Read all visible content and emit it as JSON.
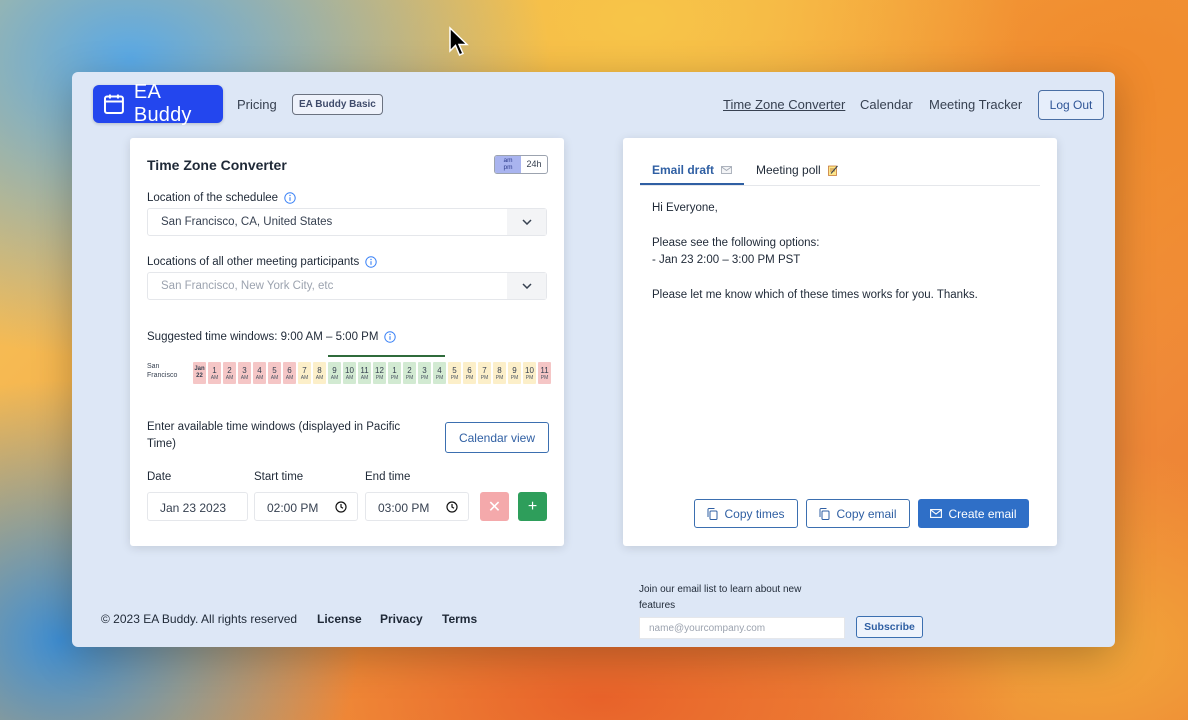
{
  "app": {
    "logo_text": "EA Buddy",
    "pricing_link": "Pricing",
    "plan_badge": "EA Buddy Basic"
  },
  "nav": {
    "time_zone_converter": "Time Zone Converter",
    "calendar": "Calendar",
    "meeting_tracker": "Meeting Tracker",
    "logout": "Log Out"
  },
  "converter": {
    "title": "Time Zone Converter",
    "toggle_ampm_top": "am",
    "toggle_ampm_bottom": "pm",
    "toggle_24h": "24h",
    "schedulee_label": "Location of the schedulee",
    "schedulee_value": "San Francisco, CA, United States",
    "participants_label": "Locations of all other meeting participants",
    "participants_placeholder": "San Francisco, New York City, etc",
    "suggested_label": "Suggested time windows: 9:00 AM – 5:00 PM",
    "timeline_location_line1": "San",
    "timeline_location_line2": "Francisco",
    "hours": [
      {
        "top": "Jan",
        "bottom": "22",
        "color": "red"
      },
      {
        "top": "1",
        "bottom": "AM",
        "color": "red"
      },
      {
        "top": "2",
        "bottom": "AM",
        "color": "red"
      },
      {
        "top": "3",
        "bottom": "AM",
        "color": "red"
      },
      {
        "top": "4",
        "bottom": "AM",
        "color": "red"
      },
      {
        "top": "5",
        "bottom": "AM",
        "color": "red"
      },
      {
        "top": "6",
        "bottom": "AM",
        "color": "red"
      },
      {
        "top": "7",
        "bottom": "AM",
        "color": "yellow"
      },
      {
        "top": "8",
        "bottom": "AM",
        "color": "yellow"
      },
      {
        "top": "9",
        "bottom": "AM",
        "color": "green"
      },
      {
        "top": "10",
        "bottom": "AM",
        "color": "green"
      },
      {
        "top": "11",
        "bottom": "AM",
        "color": "green"
      },
      {
        "top": "12",
        "bottom": "PM",
        "color": "green"
      },
      {
        "top": "1",
        "bottom": "PM",
        "color": "green"
      },
      {
        "top": "2",
        "bottom": "PM",
        "color": "green"
      },
      {
        "top": "3",
        "bottom": "PM",
        "color": "green"
      },
      {
        "top": "4",
        "bottom": "PM",
        "color": "green"
      },
      {
        "top": "5",
        "bottom": "PM",
        "color": "yellow"
      },
      {
        "top": "6",
        "bottom": "PM",
        "color": "yellow"
      },
      {
        "top": "7",
        "bottom": "PM",
        "color": "yellow"
      },
      {
        "top": "8",
        "bottom": "PM",
        "color": "yellow"
      },
      {
        "top": "9",
        "bottom": "PM",
        "color": "yellow"
      },
      {
        "top": "10",
        "bottom": "PM",
        "color": "yellow"
      },
      {
        "top": "11",
        "bottom": "PM",
        "color": "red"
      }
    ],
    "available_label": "Enter available time windows (displayed in Pacific Time)",
    "calendar_view_button": "Calendar view",
    "date_label": "Date",
    "start_label": "Start time",
    "end_label": "End time",
    "date_value": "Jan 23 2023",
    "start_value": "02:00 PM",
    "end_value": "03:00 PM",
    "remove_symbol": "✕",
    "add_symbol": "+"
  },
  "email": {
    "tab_email": "Email draft",
    "tab_poll": "Meeting poll",
    "greeting": "Hi Everyone,",
    "intro": "Please see the following options:",
    "option": "- Jan 23 2:00 – 3:00 PM PST",
    "closing": "Please let me know which of these times works for you. Thanks.",
    "copy_times": "Copy times",
    "copy_email": "Copy email",
    "create_email": "Create email"
  },
  "footer": {
    "copyright": "© 2023 EA Buddy. All rights reserved",
    "license": "License",
    "privacy": "Privacy",
    "terms": "Terms",
    "newsletter_text": "Join our email list to learn about new features",
    "email_placeholder": "name@yourcompany.com",
    "subscribe": "Subscribe"
  },
  "colors": {
    "brand_blue": "#2346ee",
    "accent": "#2f6fc7",
    "add_green": "#2e9e5b",
    "remove_red": "#f4a9ab"
  }
}
